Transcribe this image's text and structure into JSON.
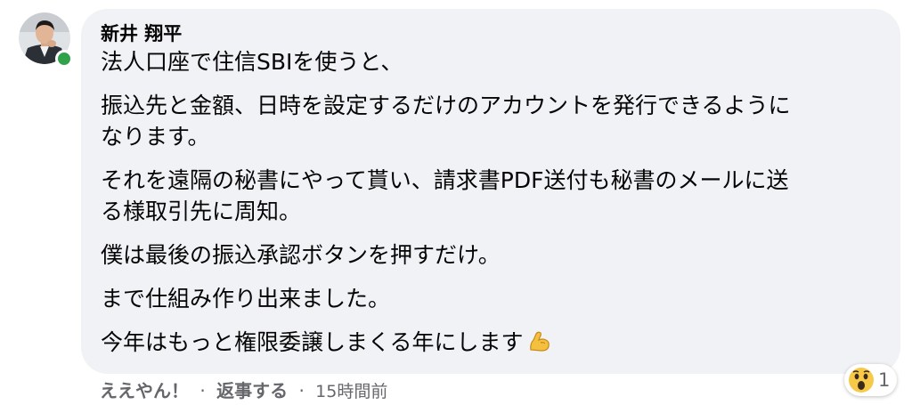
{
  "comment": {
    "author": "新井 翔平",
    "paragraphs": [
      "法人口座で住信SBIを使うと、",
      "振込先と金額、日時を設定するだけのアカウントを発行できるように\nなります。",
      "それを遠隔の秘書にやって貰い、請求書PDF送付も秘書のメールに送\nる様取引先に周知。",
      "僕は最後の振込承認ボタンを押すだけ。",
      "まで仕組み作り出来ました。",
      "今年はもっと権限委譲しまくる年にします"
    ],
    "trailing_emoji": "flexed-biceps-emoji",
    "online_status_color": "#31a24c",
    "bubble_color": "#f0f2f5"
  },
  "reaction": {
    "icon": "wow-reaction-icon",
    "count": "1"
  },
  "actions": {
    "like_label": "ええやん！",
    "reply_label": "返事する",
    "separator": "·",
    "timestamp": "15時間前"
  }
}
